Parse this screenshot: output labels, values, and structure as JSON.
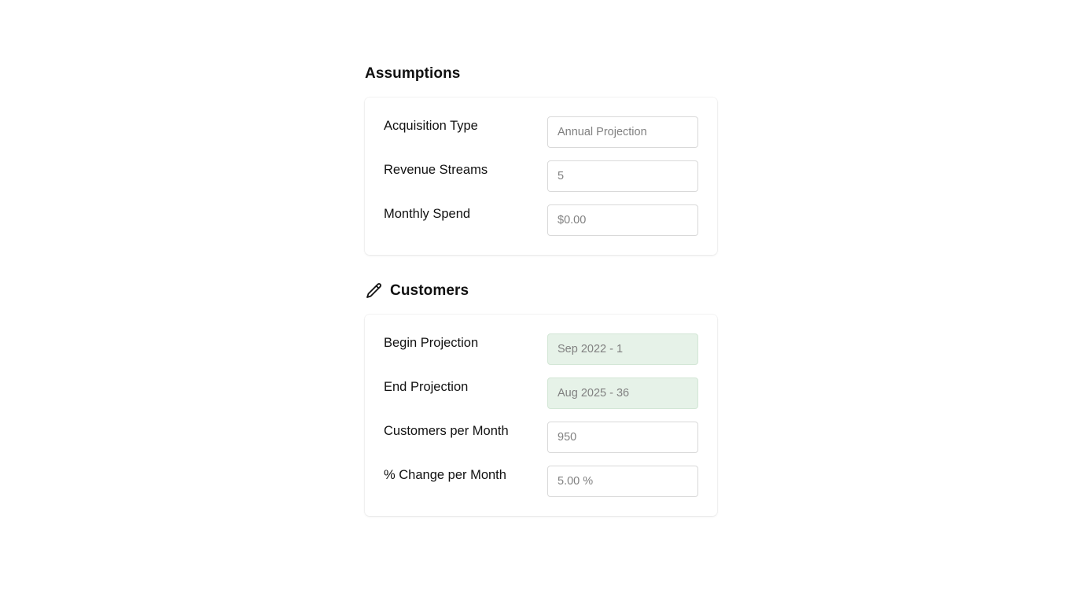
{
  "assumptions": {
    "title": "Assumptions",
    "rows": [
      {
        "label": "Acquisition Type",
        "value": "Annual Projection"
      },
      {
        "label": "Revenue Streams",
        "value": "5"
      },
      {
        "label": "Monthly Spend",
        "value": "$0.00"
      }
    ]
  },
  "customers": {
    "title": "Customers",
    "icon": "pencil-icon",
    "rows": [
      {
        "label": "Begin Projection",
        "value": "Sep 2022 - 1"
      },
      {
        "label": "End Projection",
        "value": "Aug 2025 - 36"
      },
      {
        "label": "Customers per Month",
        "value": "950"
      },
      {
        "label": "% Change per Month",
        "value": "5.00 %"
      }
    ]
  },
  "colors": {
    "readonly_field_bg": "#e6f2e8",
    "field_border": "#d9d9d9",
    "field_text": "#808080"
  }
}
